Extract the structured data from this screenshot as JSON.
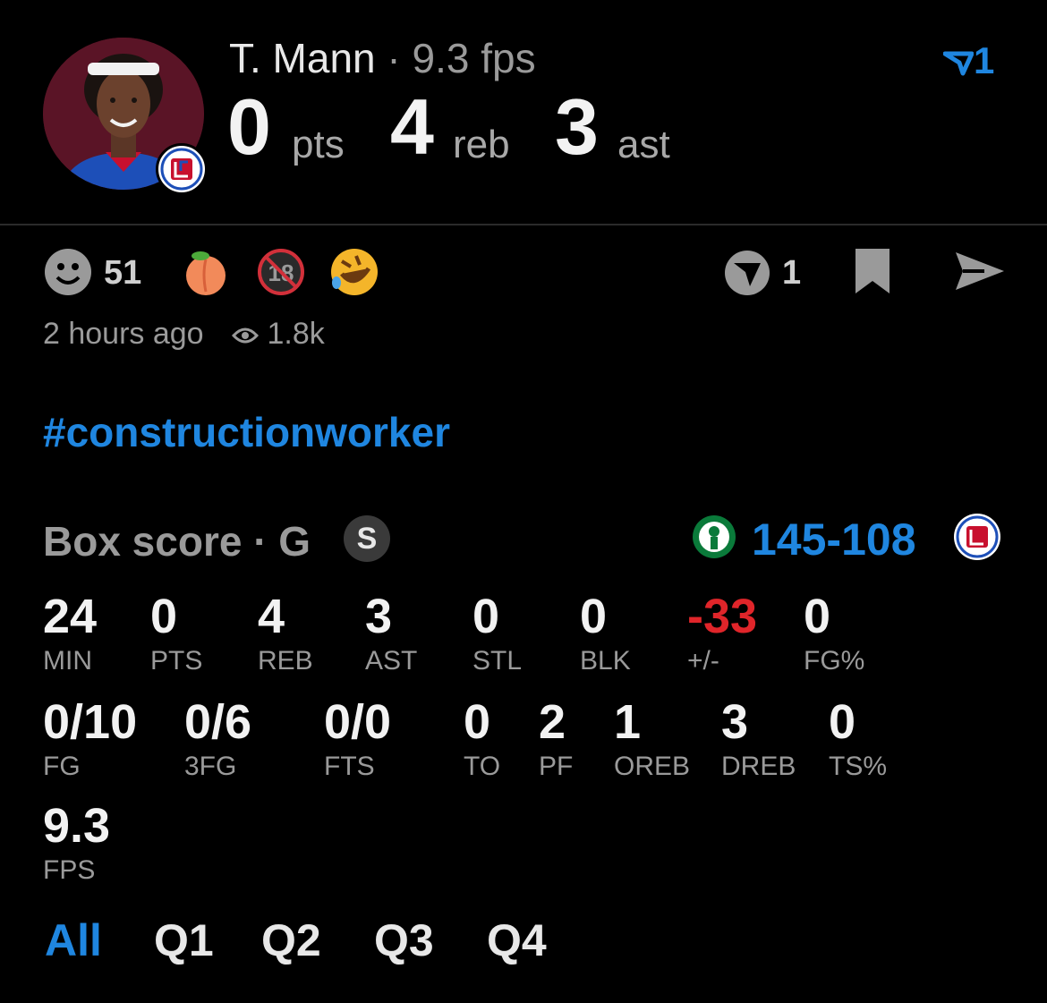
{
  "header": {
    "player_name": "T. Mann",
    "separator": "·",
    "fps_label": "9.3 fps",
    "headline_stats": [
      {
        "value": "0",
        "unit": "pts"
      },
      {
        "value": "4",
        "unit": "reb"
      },
      {
        "value": "3",
        "unit": "ast"
      }
    ],
    "top_vote_count": "1"
  },
  "reactions": {
    "smile_count": "51",
    "vote_count": "1",
    "icons": [
      "smile-icon",
      "peach-icon",
      "no-under-18-icon",
      "rofl-icon"
    ]
  },
  "meta": {
    "time_ago": "2 hours ago",
    "views": "1.8k"
  },
  "hashtag": "#constructionworker",
  "box_score": {
    "title": "Box score · G",
    "badge": "S",
    "score": "145-108",
    "row1": [
      {
        "value": "24",
        "label": "MIN"
      },
      {
        "value": "0",
        "label": "PTS"
      },
      {
        "value": "4",
        "label": "REB"
      },
      {
        "value": "3",
        "label": "AST"
      },
      {
        "value": "0",
        "label": "STL"
      },
      {
        "value": "0",
        "label": "BLK"
      },
      {
        "value": "-33",
        "label": "+/-"
      },
      {
        "value": "0",
        "label": "FG%"
      }
    ],
    "row2": [
      {
        "value": "0/10",
        "label": "FG"
      },
      {
        "value": "0/6",
        "label": "3FG"
      },
      {
        "value": "0/0",
        "label": "FTS"
      },
      {
        "value": "0",
        "label": "TO"
      },
      {
        "value": "2",
        "label": "PF"
      },
      {
        "value": "1",
        "label": "OREB"
      },
      {
        "value": "3",
        "label": "DREB"
      },
      {
        "value": "0",
        "label": "TS%"
      }
    ],
    "row3": [
      {
        "value": "9.3",
        "label": "FPS"
      }
    ]
  },
  "quarter_tabs": [
    "All",
    "Q1",
    "Q2",
    "Q3",
    "Q4"
  ],
  "colors": {
    "accent": "#1f86e0",
    "negative": "#e0252a",
    "background": "#000000"
  }
}
